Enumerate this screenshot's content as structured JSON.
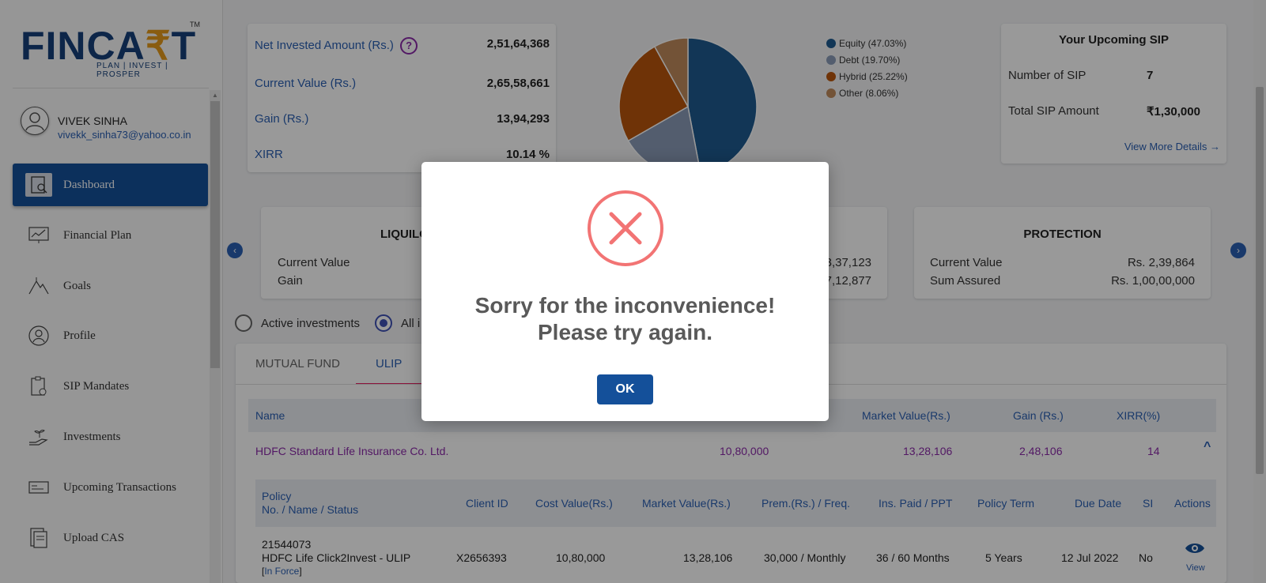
{
  "brand": {
    "logo_main": "FINCA",
    "logo_accent": "₹",
    "logo_end": "T",
    "logo_tm": "TM",
    "logo_tagline": "PLAN | INVEST | PROSPER"
  },
  "user": {
    "name": "VIVEK SINHA",
    "email": "vivekk_sinha73@yahoo.co.in"
  },
  "sidebar": {
    "items": [
      {
        "label": "Dashboard",
        "icon": "dashboard-icon",
        "active": true
      },
      {
        "label": "Financial Plan",
        "icon": "chart-icon"
      },
      {
        "label": "Goals",
        "icon": "mountain-icon"
      },
      {
        "label": "Profile",
        "icon": "user-icon"
      },
      {
        "label": "SIP Mandates",
        "icon": "clipboard-icon"
      },
      {
        "label": "Investments",
        "icon": "hand-plant-icon"
      },
      {
        "label": "Upcoming Transactions",
        "icon": "card-icon"
      },
      {
        "label": "Upload CAS",
        "icon": "document-icon"
      }
    ]
  },
  "summary": {
    "net_invested_label": "Net Invested Amount (Rs.)",
    "net_invested_value": "2,51,64,368",
    "current_value_label": "Current Value (Rs.)",
    "current_value_value": "2,65,58,661",
    "gain_label": "Gain (Rs.)",
    "gain_value": "13,94,293",
    "xirr_label": "XIRR",
    "xirr_value": "10.14 %",
    "help_icon": "?"
  },
  "allocation": {
    "legend": [
      {
        "label": "Equity (47.03%)",
        "value": 47.03,
        "color": "#1f5a8f"
      },
      {
        "label": "Debt (19.70%)",
        "value": 19.7,
        "color": "#8a9bb8"
      },
      {
        "label": "Hybrid (25.22%)",
        "value": 25.22,
        "color": "#b9560c"
      },
      {
        "label": "Other (8.06%)",
        "value": 8.06,
        "color": "#c08a5c"
      }
    ]
  },
  "upcoming_sip": {
    "title": "Your Upcoming SIP",
    "count_label": "Number of SIP",
    "count_value": "7",
    "amount_label": "Total SIP Amount",
    "amount_value": "₹1,30,000",
    "link": "View More Details →"
  },
  "categories": {
    "liquid": {
      "title": "LIQUILO",
      "cv_label": "Current Value",
      "gain_label": "Gain"
    },
    "middle": {
      "cv_value": "3,37,123",
      "gain_value": "7,12,877"
    },
    "protection": {
      "title": "PROTECTION",
      "cv_label": "Current Value",
      "cv_value": "Rs. 2,39,864",
      "sa_label": "Sum Assured",
      "sa_value": "Rs. 1,00,00,000"
    },
    "prev": "‹",
    "next": "›"
  },
  "filter": {
    "active_label": "Active investments",
    "all_label": "All i"
  },
  "tabs": [
    {
      "label": "MUTUAL FUND"
    },
    {
      "label": "ULIP",
      "active": true
    }
  ],
  "table": {
    "headers": {
      "name": "Name",
      "market": "Market Value(Rs.)",
      "gain": "Gain (Rs.)",
      "xirr": "XIRR(%)"
    },
    "row": {
      "name": "HDFC Standard Life Insurance Co. Ltd.",
      "cost": "10,80,000",
      "market": "13,28,106",
      "gain": "2,48,106",
      "xirr": "14",
      "toggle": "^"
    },
    "sub_headers": {
      "policy_1": "Policy",
      "policy_2": "No. / Name / Status",
      "client": "Client ID",
      "cost": "Cost Value(Rs.)",
      "market": "Market Value(Rs.)",
      "prem": "Prem.(Rs.) / Freq.",
      "ins": "Ins. Paid / PPT",
      "term": "Policy Term",
      "due": "Due Date",
      "si": "SI",
      "actions": "Actions"
    },
    "sub_row": {
      "policy_no": "21544073",
      "policy_name": "HDFC Life Click2Invest - ULIP",
      "status": "In Force",
      "client": "X2656393",
      "cost": "10,80,000",
      "market": "13,28,106",
      "prem": "30,000 / Monthly",
      "ins": "36 / 60 Months",
      "term": "5 Years",
      "due": "12 Jul 2022",
      "si": "No",
      "action": "View"
    }
  },
  "modal": {
    "message": "Sorry for the inconvenience! Please try again.",
    "ok_label": "OK"
  }
}
